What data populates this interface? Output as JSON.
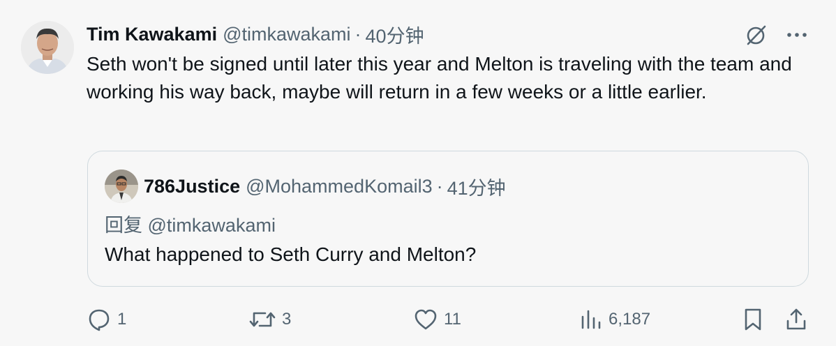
{
  "tweet": {
    "author": {
      "display_name": "Tim Kawakami",
      "handle": "@timkawakami",
      "avatar_icon": "avatar-photo"
    },
    "separator": "·",
    "time": "40分钟",
    "text": "Seth won't be signed until later this year and Melton is traveling with the team and working his way back, maybe will return in a few weeks or a little earlier.",
    "top_actions": {
      "grok_icon": "grok-icon",
      "more_icon": "more-icon"
    },
    "quote": {
      "author": {
        "display_name": "786Justice",
        "handle": "@MohammedKomail3",
        "avatar_icon": "avatar-photo"
      },
      "separator": "·",
      "time": "41分钟",
      "reply_prefix": "回复",
      "reply_to": "@timkawakami",
      "text": "What happened to Seth Curry and Melton?"
    },
    "actions": {
      "replies": "1",
      "reposts": "3",
      "likes": "11",
      "views": "6,187"
    }
  },
  "colors": {
    "background": "#f7f7f7",
    "text_primary": "#0f1419",
    "text_secondary": "#536471",
    "border": "#cfd9de"
  }
}
